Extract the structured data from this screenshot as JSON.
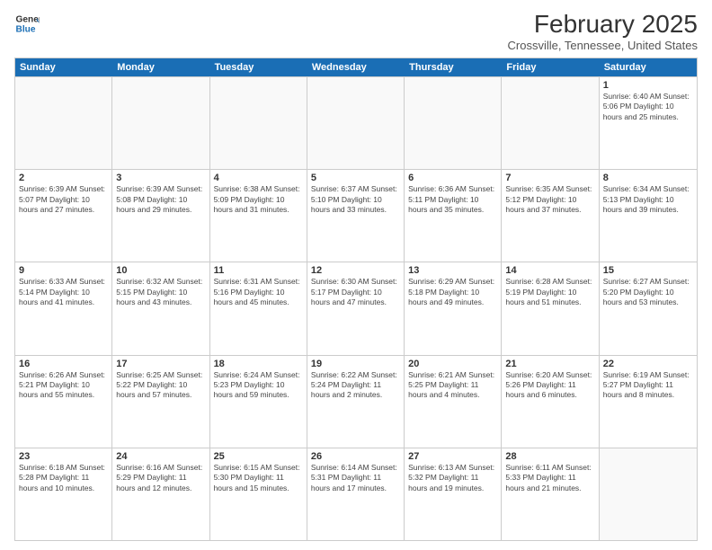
{
  "header": {
    "logo_line1": "General",
    "logo_line2": "Blue",
    "month": "February 2025",
    "location": "Crossville, Tennessee, United States"
  },
  "weekdays": [
    "Sunday",
    "Monday",
    "Tuesday",
    "Wednesday",
    "Thursday",
    "Friday",
    "Saturday"
  ],
  "weeks": [
    [
      {
        "day": "",
        "info": ""
      },
      {
        "day": "",
        "info": ""
      },
      {
        "day": "",
        "info": ""
      },
      {
        "day": "",
        "info": ""
      },
      {
        "day": "",
        "info": ""
      },
      {
        "day": "",
        "info": ""
      },
      {
        "day": "1",
        "info": "Sunrise: 6:40 AM\nSunset: 5:06 PM\nDaylight: 10 hours and 25 minutes."
      }
    ],
    [
      {
        "day": "2",
        "info": "Sunrise: 6:39 AM\nSunset: 5:07 PM\nDaylight: 10 hours and 27 minutes."
      },
      {
        "day": "3",
        "info": "Sunrise: 6:39 AM\nSunset: 5:08 PM\nDaylight: 10 hours and 29 minutes."
      },
      {
        "day": "4",
        "info": "Sunrise: 6:38 AM\nSunset: 5:09 PM\nDaylight: 10 hours and 31 minutes."
      },
      {
        "day": "5",
        "info": "Sunrise: 6:37 AM\nSunset: 5:10 PM\nDaylight: 10 hours and 33 minutes."
      },
      {
        "day": "6",
        "info": "Sunrise: 6:36 AM\nSunset: 5:11 PM\nDaylight: 10 hours and 35 minutes."
      },
      {
        "day": "7",
        "info": "Sunrise: 6:35 AM\nSunset: 5:12 PM\nDaylight: 10 hours and 37 minutes."
      },
      {
        "day": "8",
        "info": "Sunrise: 6:34 AM\nSunset: 5:13 PM\nDaylight: 10 hours and 39 minutes."
      }
    ],
    [
      {
        "day": "9",
        "info": "Sunrise: 6:33 AM\nSunset: 5:14 PM\nDaylight: 10 hours and 41 minutes."
      },
      {
        "day": "10",
        "info": "Sunrise: 6:32 AM\nSunset: 5:15 PM\nDaylight: 10 hours and 43 minutes."
      },
      {
        "day": "11",
        "info": "Sunrise: 6:31 AM\nSunset: 5:16 PM\nDaylight: 10 hours and 45 minutes."
      },
      {
        "day": "12",
        "info": "Sunrise: 6:30 AM\nSunset: 5:17 PM\nDaylight: 10 hours and 47 minutes."
      },
      {
        "day": "13",
        "info": "Sunrise: 6:29 AM\nSunset: 5:18 PM\nDaylight: 10 hours and 49 minutes."
      },
      {
        "day": "14",
        "info": "Sunrise: 6:28 AM\nSunset: 5:19 PM\nDaylight: 10 hours and 51 minutes."
      },
      {
        "day": "15",
        "info": "Sunrise: 6:27 AM\nSunset: 5:20 PM\nDaylight: 10 hours and 53 minutes."
      }
    ],
    [
      {
        "day": "16",
        "info": "Sunrise: 6:26 AM\nSunset: 5:21 PM\nDaylight: 10 hours and 55 minutes."
      },
      {
        "day": "17",
        "info": "Sunrise: 6:25 AM\nSunset: 5:22 PM\nDaylight: 10 hours and 57 minutes."
      },
      {
        "day": "18",
        "info": "Sunrise: 6:24 AM\nSunset: 5:23 PM\nDaylight: 10 hours and 59 minutes."
      },
      {
        "day": "19",
        "info": "Sunrise: 6:22 AM\nSunset: 5:24 PM\nDaylight: 11 hours and 2 minutes."
      },
      {
        "day": "20",
        "info": "Sunrise: 6:21 AM\nSunset: 5:25 PM\nDaylight: 11 hours and 4 minutes."
      },
      {
        "day": "21",
        "info": "Sunrise: 6:20 AM\nSunset: 5:26 PM\nDaylight: 11 hours and 6 minutes."
      },
      {
        "day": "22",
        "info": "Sunrise: 6:19 AM\nSunset: 5:27 PM\nDaylight: 11 hours and 8 minutes."
      }
    ],
    [
      {
        "day": "23",
        "info": "Sunrise: 6:18 AM\nSunset: 5:28 PM\nDaylight: 11 hours and 10 minutes."
      },
      {
        "day": "24",
        "info": "Sunrise: 6:16 AM\nSunset: 5:29 PM\nDaylight: 11 hours and 12 minutes."
      },
      {
        "day": "25",
        "info": "Sunrise: 6:15 AM\nSunset: 5:30 PM\nDaylight: 11 hours and 15 minutes."
      },
      {
        "day": "26",
        "info": "Sunrise: 6:14 AM\nSunset: 5:31 PM\nDaylight: 11 hours and 17 minutes."
      },
      {
        "day": "27",
        "info": "Sunrise: 6:13 AM\nSunset: 5:32 PM\nDaylight: 11 hours and 19 minutes."
      },
      {
        "day": "28",
        "info": "Sunrise: 6:11 AM\nSunset: 5:33 PM\nDaylight: 11 hours and 21 minutes."
      },
      {
        "day": "",
        "info": ""
      }
    ]
  ]
}
